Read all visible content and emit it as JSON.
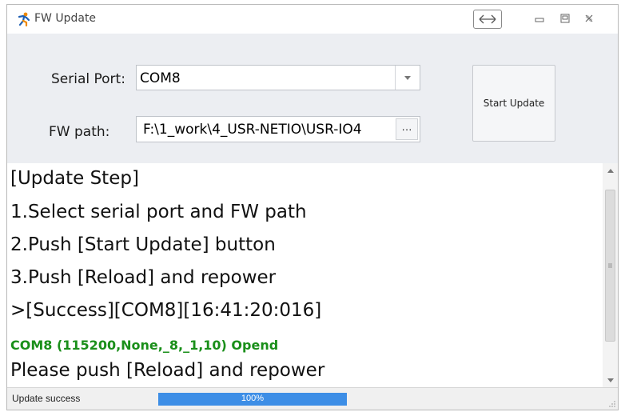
{
  "window": {
    "title": "FW Update",
    "icons": {
      "app": "person-run-icon",
      "swap": "arrows-horizontal-icon",
      "minimize": "minimize-icon",
      "maximize": "maximize-icon",
      "close": "close-icon"
    }
  },
  "settings": {
    "serial_port_label": "Serial Port:",
    "serial_port_value": "COM8",
    "fw_path_label": "FW path:",
    "fw_path_value": "F:\\1_work\\4_USR-NETIO\\USR-IO4",
    "browse_label": "···",
    "start_update_label": "Start Update"
  },
  "log": {
    "lines": [
      "[Update Step]",
      "1.Select serial port and FW path",
      "2.Push [Start Update] button",
      "3.Push [Reload] and repower",
      ">[Success][COM8][16:41:20:016]",
      "COM8 (115200,None,_8,_1,10) Opend",
      "Please push [Reload] and repower"
    ]
  },
  "status": {
    "text": "Update success",
    "progress_fraction": 1.0,
    "progress_label": "100%"
  },
  "colors": {
    "panel_bg": "#eceef2",
    "success_green": "#1a8f1a",
    "progress_blue": "#3d8ee6"
  }
}
